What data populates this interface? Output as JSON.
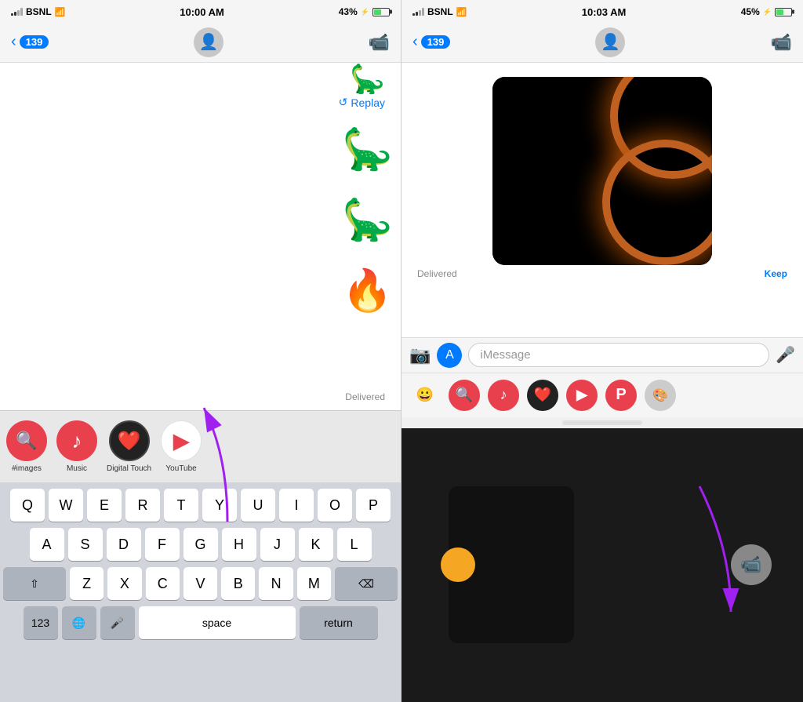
{
  "left": {
    "status": {
      "carrier": "BSNL",
      "time": "10:00 AM",
      "battery_pct": "43%",
      "charging": true
    },
    "nav": {
      "back_count": "139",
      "video_call_icon": "📹"
    },
    "messages": {
      "replay_label": "Replay",
      "delivered_label": "Delivered"
    },
    "app_icons": [
      {
        "label": "#images",
        "class": "icon-images",
        "icon": "🔍"
      },
      {
        "label": "Music",
        "class": "icon-music",
        "icon": "♪"
      },
      {
        "label": "Digital Touch",
        "class": "icon-digital-touch",
        "icon": "❤️"
      },
      {
        "label": "YouTube",
        "class": "icon-youtube",
        "icon": "▶"
      }
    ],
    "keyboard": {
      "rows": [
        [
          "Q",
          "W",
          "E",
          "R",
          "T",
          "Y",
          "U",
          "I",
          "O",
          "P"
        ],
        [
          "A",
          "S",
          "D",
          "F",
          "G",
          "H",
          "J",
          "K",
          "L"
        ],
        [
          "⇧",
          "Z",
          "X",
          "C",
          "V",
          "B",
          "N",
          "M",
          "⌫"
        ],
        [
          "123",
          "🌐",
          "🎤",
          "space",
          "return"
        ]
      ],
      "space_label": "space",
      "return_label": "return",
      "num_label": "123"
    }
  },
  "right": {
    "status": {
      "carrier": "BSNL",
      "time": "10:03 AM",
      "battery_pct": "45%",
      "charging": true
    },
    "nav": {
      "back_count": "139"
    },
    "messages": {
      "delivered_label": "Delivered",
      "keep_label": "Keep"
    },
    "input": {
      "placeholder": "iMessage"
    },
    "app_icons": [
      "😀",
      "🔍",
      "♪",
      "❤️",
      "▶",
      "P",
      "🎨"
    ]
  },
  "arrow_left": {
    "color": "#a020f0",
    "label": "Digital Touch arrow"
  },
  "arrow_right": {
    "color": "#a020f0",
    "label": "video icon arrow"
  }
}
